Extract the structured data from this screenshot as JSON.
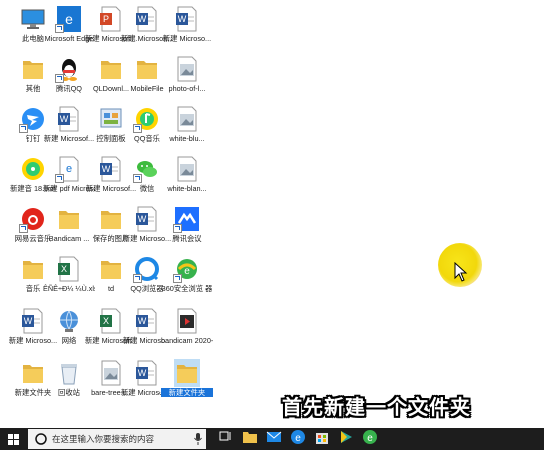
{
  "desktop": {
    "icons": [
      {
        "id": "this-pc",
        "label": "此电脑",
        "icon": "pc-icon"
      },
      {
        "id": "edge",
        "label": "Microsoft Edge",
        "icon": "edge-icon"
      },
      {
        "id": "ppt1",
        "label": "新建 Microsoft...",
        "icon": "powerpoint-file-icon"
      },
      {
        "id": "word1",
        "label": "新建 Microsoft...",
        "icon": "word-file-icon"
      },
      {
        "id": "word2",
        "label": "新建 Microso...",
        "icon": "word-file-icon"
      },
      {
        "id": "other",
        "label": "其他",
        "icon": "folder-icon"
      },
      {
        "id": "tencent-qq",
        "label": "腾讯QQ",
        "icon": "qq-icon"
      },
      {
        "id": "qldown",
        "label": "QLDownl...",
        "icon": "folder-icon"
      },
      {
        "id": "mobilefile",
        "label": "MobileFile",
        "icon": "folder-icon"
      },
      {
        "id": "photo-of",
        "label": "photo-of-l...",
        "icon": "image-file-icon"
      },
      {
        "id": "dingding",
        "label": "钉钉",
        "icon": "dingtalk-icon"
      },
      {
        "id": "word3",
        "label": "新建 Microsof...",
        "icon": "word-file-icon"
      },
      {
        "id": "control-panel",
        "label": "控制面板",
        "icon": "control-panel-icon"
      },
      {
        "id": "qq-music",
        "label": "QQ音乐",
        "icon": "qq-music-icon"
      },
      {
        "id": "white-blu",
        "label": "white-blu...",
        "icon": "image-file-icon"
      },
      {
        "id": "xinjuan",
        "label": "新建音 18.tkm",
        "icon": "music-app-icon"
      },
      {
        "id": "pdf",
        "label": "新建 pdf Microsof...",
        "icon": "pdf-edge-icon"
      },
      {
        "id": "word4",
        "label": "新建 Microsof...",
        "icon": "word-file-icon"
      },
      {
        "id": "wechat",
        "label": "微信",
        "icon": "wechat-icon"
      },
      {
        "id": "white-blan",
        "label": "white-blan...",
        "icon": "image-file-icon"
      },
      {
        "id": "netease-music",
        "label": "网易云音乐",
        "icon": "netease-music-icon"
      },
      {
        "id": "bandicam",
        "label": "Bandicam ...",
        "icon": "folder-icon"
      },
      {
        "id": "saved-pics",
        "label": "保存的图片",
        "icon": "folder-icon"
      },
      {
        "id": "word5",
        "label": "新建 Microso...",
        "icon": "word-file-icon"
      },
      {
        "id": "tencent-meeting",
        "label": "腾讯会议",
        "icon": "tencent-meeting-icon"
      },
      {
        "id": "music",
        "label": "音乐",
        "icon": "folder-icon"
      },
      {
        "id": "xls",
        "label": "ÊÑÊ÷Ð¼ ¼Ù.xls",
        "icon": "excel-file-icon"
      },
      {
        "id": "td",
        "label": "td",
        "icon": "folder-icon"
      },
      {
        "id": "qq-browser",
        "label": "QQ浏览器",
        "icon": "qq-browser-icon"
      },
      {
        "id": "360",
        "label": "360安全浏览 器",
        "icon": "360-browser-icon"
      },
      {
        "id": "word6",
        "label": "新建 Microso...",
        "icon": "word-file-icon"
      },
      {
        "id": "network",
        "label": "网络",
        "icon": "network-icon"
      },
      {
        "id": "excel1",
        "label": "新建 Microsoft ...",
        "icon": "excel-file-icon"
      },
      {
        "id": "word7",
        "label": "新建 Microso...",
        "icon": "word-file-icon"
      },
      {
        "id": "bandicam-video",
        "label": "bandicam 2020-05-0...",
        "icon": "video-file-icon"
      },
      {
        "id": "new-folder",
        "label": "新建文件夹",
        "icon": "folder-icon"
      },
      {
        "id": "recycle-bin",
        "label": "回收站",
        "icon": "recycle-bin-icon"
      },
      {
        "id": "bare-tree",
        "label": "bare-tree-i...",
        "icon": "image-file-icon"
      },
      {
        "id": "word8",
        "label": "新建 Microsoft...",
        "icon": "word-file-icon"
      },
      {
        "id": "new-folder-selected",
        "label": "新建文件夹",
        "icon": "folder-icon",
        "selected": true
      }
    ]
  },
  "caption": "首先新建一个文件夹",
  "taskbar": {
    "search_placeholder": "在这里输入你要搜索的内容",
    "apps": [
      "task-view-icon",
      "file-explorer-icon",
      "mail-icon",
      "edge-icon",
      "store-icon",
      "media-player-icon",
      "360-browser-icon"
    ]
  },
  "colors": {
    "taskbar": "#1d1d1d",
    "selection": "#1a73d9",
    "folder": "#f2c94c",
    "word": "#2b579a",
    "excel": "#217346",
    "powerpoint": "#d24726"
  }
}
